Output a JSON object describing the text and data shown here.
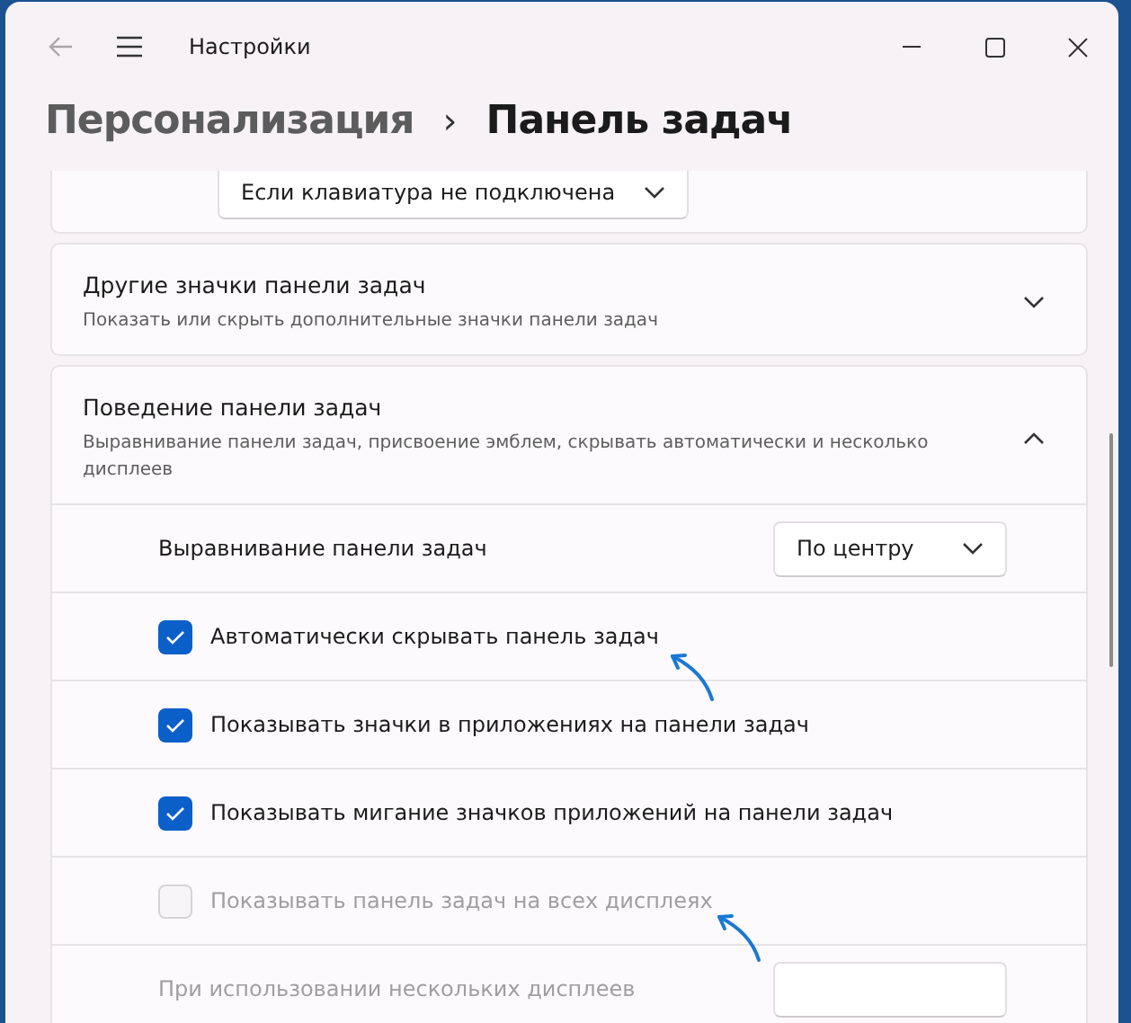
{
  "window": {
    "title": "Настройки",
    "back_disabled": true
  },
  "breadcrumb": {
    "parent": "Персонализация",
    "separator": "›",
    "current": "Панель задач"
  },
  "top_card": {
    "dropdown_value": "Если клавиатура не подключена"
  },
  "sections": [
    {
      "title": "Другие значки панели задач",
      "subtitle": "Показать или скрыть дополнительные значки панели задач",
      "expanded": false
    },
    {
      "title": "Поведение панели задач",
      "subtitle": "Выравнивание панели задач, присвоение эмблем, скрывать автоматически и несколько дисплеев",
      "expanded": true,
      "rows": [
        {
          "kind": "dropdown",
          "label": "Выравнивание панели задач",
          "value": "По центру",
          "disabled": false
        },
        {
          "kind": "checkbox",
          "label": "Автоматически скрывать панель задач",
          "checked": true,
          "disabled": false
        },
        {
          "kind": "checkbox",
          "label": "Показывать значки в приложениях на панели задач",
          "checked": true,
          "disabled": false
        },
        {
          "kind": "checkbox",
          "label": "Показывать мигание значков приложений на панели задач",
          "checked": true,
          "disabled": false
        },
        {
          "kind": "checkbox",
          "label": "Показывать панель задач на всех дисплеях",
          "checked": false,
          "disabled": true
        },
        {
          "kind": "dropdown",
          "label": "При использовании нескольких дисплеев",
          "disabled": true
        }
      ]
    }
  ]
}
